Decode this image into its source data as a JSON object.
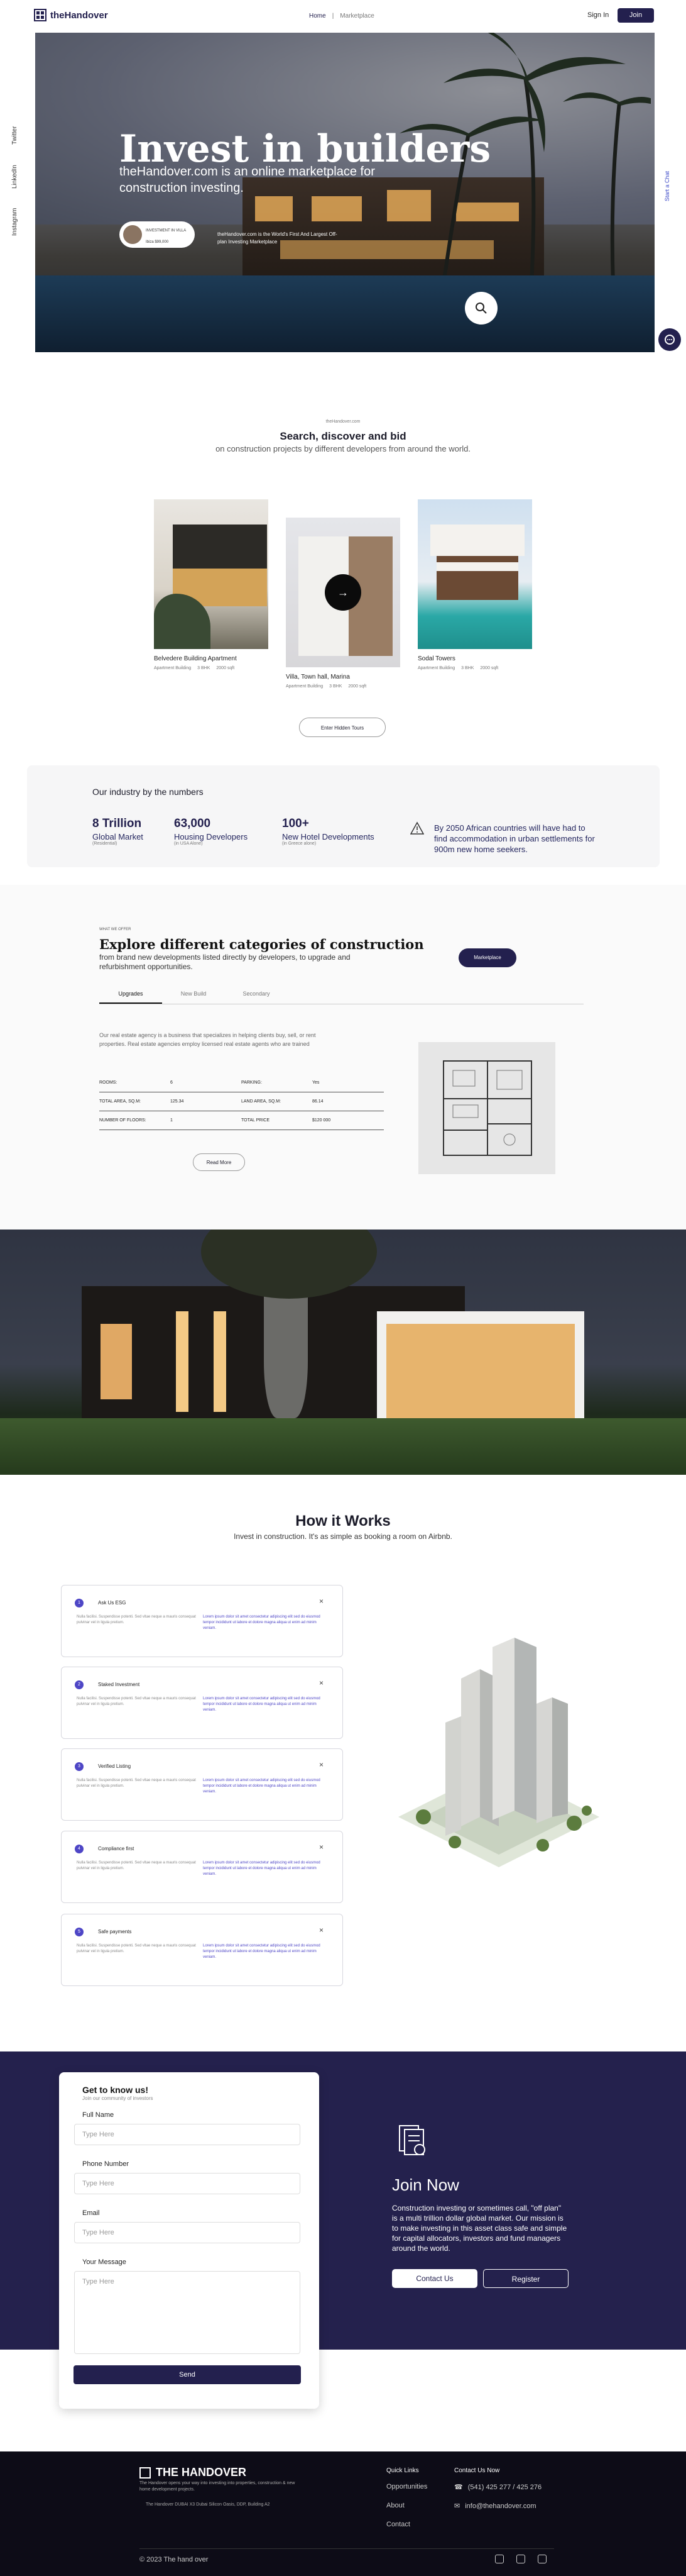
{
  "header": {
    "brand": "theHandover",
    "nav": [
      "Home",
      "Marketplace"
    ],
    "sign_in": "Sign In",
    "join": "Join"
  },
  "social_side": [
    "Twitter",
    "LinkedIn",
    "Instagram"
  ],
  "right_side": "Start a Chat",
  "hero": {
    "title": "Invest in builders",
    "subtitle": "theHandover.com is an online marketplace for construction investing.",
    "badge_line1": "INVESTMENT IN VILLA",
    "badge_line2": "Ibiza $99,000",
    "badge_caption": "theHandover.com is the World's First And Largest Off-plan Investing Marketplace"
  },
  "search_section": {
    "eyebrow": "theHandover.com",
    "title": "Search, discover and bid",
    "subtitle": "on construction projects by different developers from around the world."
  },
  "cards": [
    {
      "name": "Belvedere Building Apartment",
      "meta": [
        "Apartment Building",
        "3 BHK",
        "2000 sqft"
      ]
    },
    {
      "name": "Villa, Town hall, Marina",
      "meta": [
        "Apartment Building",
        "3 BHK",
        "2000 sqft"
      ]
    },
    {
      "name": "Sodal Towers",
      "meta": [
        "Apartment Building",
        "3 BHK",
        "2000 sqft"
      ]
    }
  ],
  "enter_button": "Enter Hidden Tours",
  "numbers": {
    "heading": "Our industry by the numbers",
    "items": [
      {
        "value": "8 Trillion",
        "label": "Global Market",
        "note": "(Residential)"
      },
      {
        "value": "63,000",
        "label": "Housing Developers",
        "note": "(in USA Alone)"
      },
      {
        "value": "100+",
        "label": "New Hotel Developments",
        "note": "(in Greece alone)"
      }
    ],
    "note": "By 2050 African countries will have had to find accommodation in urban settlements for 900m new home seekers."
  },
  "categories": {
    "eyebrow": "WHAT WE OFFER",
    "title": "Explore different categories of construction",
    "description": "from brand new developments listed directly by developers, to upgrade and refurbishment opportunities.",
    "marketplace_button": "Marketplace",
    "tabs": [
      "Upgrades",
      "New Build",
      "Secondary"
    ],
    "paragraph": "Our real estate agency is a business that specializes in helping clients buy, sell, or rent properties. Real estate agencies employ licensed real estate agents who are trained",
    "spec_rows": [
      [
        "ROOMS:",
        "6",
        "PARKING:",
        "Yes"
      ],
      [
        "TOTAL AREA, SQ.M:",
        "125.34",
        "LAND AREA, SQ.M:",
        "86.14"
      ],
      [
        "NUMBER OF FLOORS:",
        "1",
        "TOTAL PRICE",
        "$120 000"
      ]
    ],
    "read_more": "Read More"
  },
  "how_it_works": {
    "title": "How it Works",
    "subtitle": "Invest in construction. It's as simple as booking a room on Airbnb.",
    "steps": [
      {
        "num": "1",
        "title": "Ask Us ESG"
      },
      {
        "num": "2",
        "title": "Staked Investment"
      },
      {
        "num": "3",
        "title": "Verified Listing"
      },
      {
        "num": "4",
        "title": "Compliance first"
      },
      {
        "num": "5",
        "title": "Safe payments"
      }
    ],
    "body_left": "Nulla facilisi. Suspendisse potenti. Sed vitae neque a mauris consequat pulvinar vel in ligula pretium.",
    "body_right": "Lorem ipsum dolor sit amet consectetur adipiscing elit sed do eiusmod tempor incididunt ut labore et dolore magna aliqua ut enim ad minim veniam."
  },
  "join": {
    "form_title": "Get to know us!",
    "form_sub": "Join our community of investors",
    "fields": [
      {
        "label": "Full Name",
        "placeholder": "Type Here"
      },
      {
        "label": "Phone Number",
        "placeholder": "Type Here"
      },
      {
        "label": "Email",
        "placeholder": "Type Here"
      },
      {
        "label": "Your Message",
        "placeholder": "Type Here"
      }
    ],
    "send": "Send",
    "title": "Join Now",
    "description": "Construction investing or sometimes call, \"off plan\" is a multi trillion dollar global market. Our mission is to make investing in this asset class safe and simple for capital allocators, investors and fund managers around the world.",
    "contact_us": "Contact Us",
    "register": "Register"
  },
  "footer": {
    "brand": "THE HANDOVER",
    "brand_desc": "The Handover opens your way into investing into properties, construction & new home development projects.",
    "address": "The Handover DUBAI X3 Dubai Silicon Oasis, DDP, Building A2",
    "quick_links_title": "Quick Links",
    "quick_links": [
      "Opportunities",
      "About",
      "Contact"
    ],
    "contact_title": "Contact Us Now",
    "phone": "(541) 425 277 / 425 276",
    "email": "info@thehandover.com",
    "copyright": "© 2023 The hand over"
  },
  "colors": {
    "navy": "#23204e",
    "accent": "#4e46c6"
  }
}
